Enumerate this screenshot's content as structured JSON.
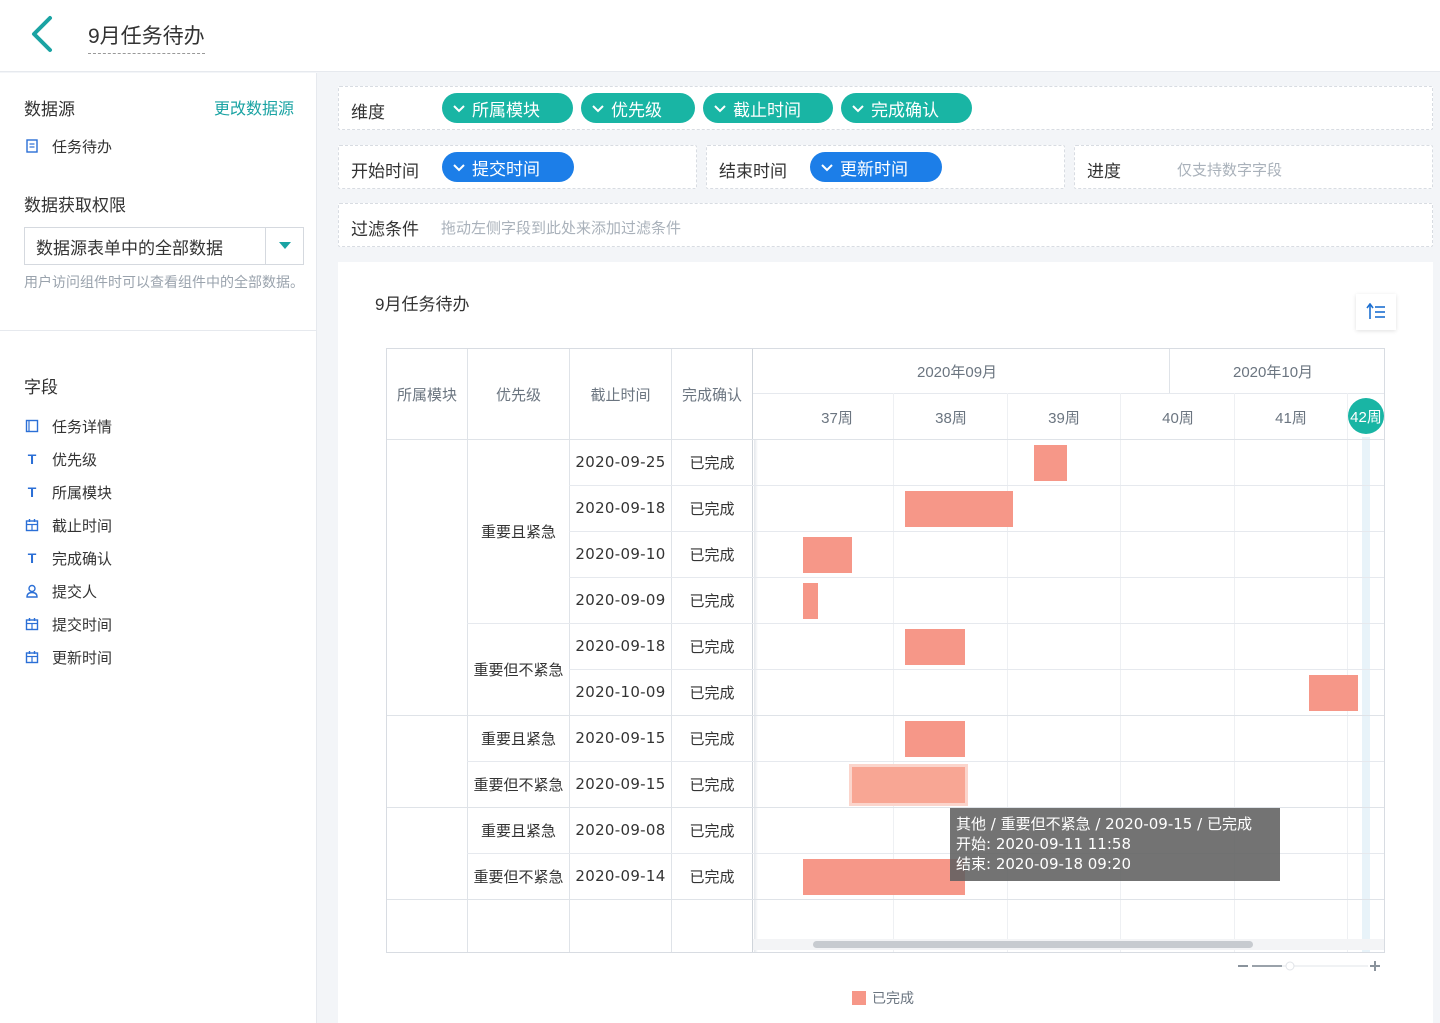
{
  "header": {
    "title": "9月任务待办"
  },
  "sidebar": {
    "datasource_label": "数据源",
    "change_datasource": "更改数据源",
    "datasource_name": "任务待办",
    "permission_label": "数据获取权限",
    "permission_value": "数据源表单中的全部数据",
    "permission_hint": "用户访问组件时可以查看组件中的全部数据。",
    "fields_label": "字段",
    "fields": [
      {
        "label": "任务详情",
        "icon": "form-icon"
      },
      {
        "label": "优先级",
        "icon": "text-icon"
      },
      {
        "label": "所属模块",
        "icon": "text-icon"
      },
      {
        "label": "截止时间",
        "icon": "calendar-icon"
      },
      {
        "label": "完成确认",
        "icon": "text-icon"
      },
      {
        "label": "提交人",
        "icon": "user-icon"
      },
      {
        "label": "提交时间",
        "icon": "calendar-icon"
      },
      {
        "label": "更新时间",
        "icon": "calendar-icon"
      }
    ]
  },
  "config": {
    "dimension_label": "维度",
    "dimensions": [
      "所属模块",
      "优先级",
      "截止时间",
      "完成确认"
    ],
    "start_label": "开始时间",
    "start_field": "提交时间",
    "end_label": "结束时间",
    "end_field": "更新时间",
    "progress_label": "进度",
    "progress_placeholder": "仅支持数字字段",
    "filter_label": "过滤条件",
    "filter_placeholder": "拖动左侧字段到此处来添加过滤条件"
  },
  "chart": {
    "title": "9月任务待办",
    "columns": [
      "所属模块",
      "优先级",
      "截止时间",
      "完成确认"
    ],
    "months": [
      "2020年09月",
      "2020年10月"
    ],
    "weeks": [
      "37周",
      "38周",
      "39周",
      "40周",
      "41周",
      "42周"
    ],
    "groups": [
      {
        "module": "",
        "priorities": [
          {
            "name": "重要且紧急",
            "rows": 4
          },
          {
            "name": "重要但不紧急",
            "rows": 2
          }
        ]
      },
      {
        "module": "",
        "priorities": [
          {
            "name": "重要且紧急",
            "rows": 1
          },
          {
            "name": "重要但不紧急",
            "rows": 1
          }
        ]
      },
      {
        "module": "",
        "priorities": [
          {
            "name": "重要且紧急",
            "rows": 1
          },
          {
            "name": "重要但不紧急",
            "rows": 1
          }
        ]
      }
    ],
    "rows": [
      {
        "deadline": "2020-09-25",
        "status": "已完成"
      },
      {
        "deadline": "2020-09-18",
        "status": "已完成"
      },
      {
        "deadline": "2020-09-10",
        "status": "已完成"
      },
      {
        "deadline": "2020-09-09",
        "status": "已完成"
      },
      {
        "deadline": "2020-09-18",
        "status": "已完成"
      },
      {
        "deadline": "2020-10-09",
        "status": "已完成"
      },
      {
        "deadline": "2020-09-15",
        "status": "已完成"
      },
      {
        "deadline": "2020-09-15",
        "status": "已完成"
      },
      {
        "deadline": "2020-09-08",
        "status": "已完成"
      },
      {
        "deadline": "2020-09-14",
        "status": "已完成"
      }
    ],
    "legend": "已完成",
    "bar_color": "#f69788",
    "tooltip": {
      "line1": "其他 / 重要但不紧急 / 2020-09-15 / 已完成",
      "line2": "开始: 2020-09-11 11:58",
      "line3": "结束: 2020-09-18 09:20"
    }
  },
  "colors": {
    "accent": "#1aa3a3",
    "pill_teal": "#19b5a4",
    "pill_blue": "#1c7ee8"
  }
}
